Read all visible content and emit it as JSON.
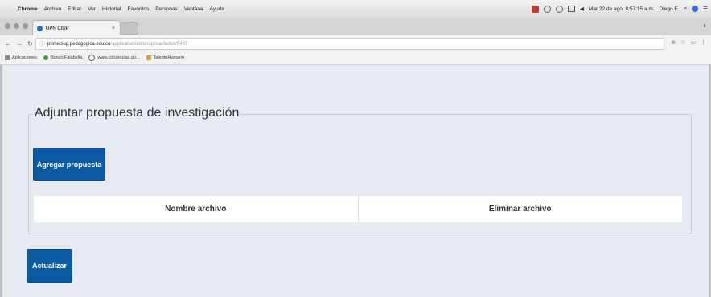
{
  "menubar": {
    "app": "Chrome",
    "items": [
      "Archivo",
      "Editar",
      "Ver",
      "Historial",
      "Favoritos",
      "Personas",
      "Ventana",
      "Ayuda"
    ],
    "datetime": "Mar 22 de ago. 8:57:15 a.m.",
    "user": "Diego E."
  },
  "tab": {
    "title": "UPN CIUP",
    "close": "×"
  },
  "address": {
    "host": "primeciup.pedagogica.edu.co",
    "path": "/application/editaraplicar/index/5487"
  },
  "bookmarks": [
    "Aplicaciones",
    "Banco Falabella",
    "www.colciencias.go...",
    "TalentoHumano"
  ],
  "form": {
    "legend": "Adjuntar propuesta de investigación",
    "add_button": "Agregar propuesta",
    "update_button": "Actualizar",
    "columns": [
      "Nombre archivo",
      "Eliminar archivo"
    ]
  }
}
